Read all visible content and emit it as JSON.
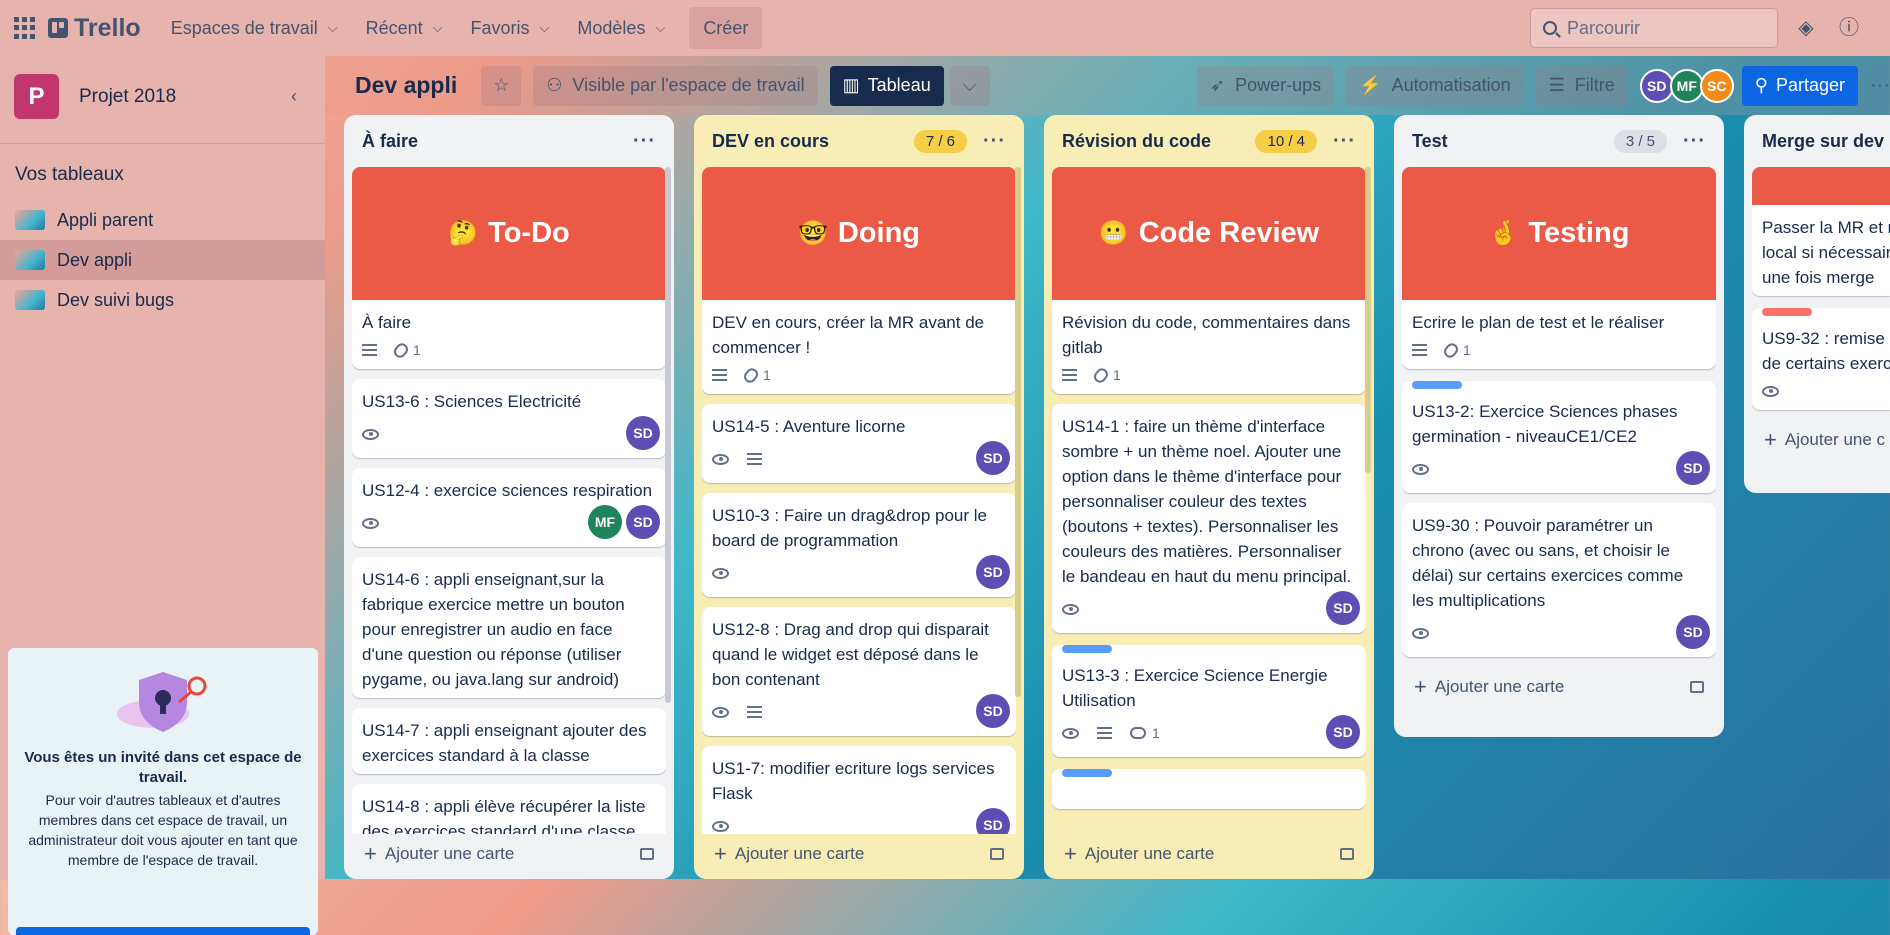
{
  "topbar": {
    "logo": "Trello",
    "menus": [
      "Espaces de travail",
      "Récent",
      "Favoris",
      "Modèles"
    ],
    "create": "Créer",
    "search_placeholder": "Parcourir"
  },
  "sidebar": {
    "workspace_initial": "P",
    "workspace_name": "Projet 2018",
    "section_title": "Vos tableaux",
    "boards": [
      {
        "label": "Appli parent"
      },
      {
        "label": "Dev appli"
      },
      {
        "label": "Dev suivi bugs"
      }
    ],
    "guest_title": "Vous êtes un invité dans cet espace de travail.",
    "guest_text": "Pour voir d'autres tableaux et d'autres membres dans cet espace de travail, un administrateur doit vous ajouter en tant que membre de l'espace de travail."
  },
  "board": {
    "title": "Dev appli",
    "visibility": "Visible par l'espace de travail",
    "view": "Tableau",
    "powerups": "Power-ups",
    "automation": "Automatisation",
    "filter": "Filtre",
    "share": "Partager",
    "members": [
      {
        "initials": "SD",
        "color": "#5e4db2"
      },
      {
        "initials": "MF",
        "color": "#1f845a"
      },
      {
        "initials": "SC",
        "color": "#f38a1a"
      }
    ]
  },
  "lists": [
    {
      "name": "À faire",
      "count": "",
      "add": "Ajouter une carte",
      "cover": {
        "emoji": "🤔",
        "title": "To-Do"
      },
      "cards": [
        {
          "text": "À faire",
          "badges": {
            "attach": "1"
          }
        },
        {
          "text": "US13-6 : Sciences Electricité",
          "members": [
            "SD"
          ]
        },
        {
          "text": "US12-4 : exercice sciences respiration",
          "members": [
            "MF",
            "SD"
          ]
        },
        {
          "text": "US14-6 : appli enseignant,sur la fabrique exercice mettre un bouton pour enregistrer un audio en face d'une question ou réponse (utiliser pygame, ou java.lang sur android)"
        },
        {
          "text": "US14-7 : appli enseignant ajouter des exercices standard à la classe"
        },
        {
          "text": "US14-8 : appli élève récupérer la liste des exercices standard d'une classe"
        }
      ]
    },
    {
      "name": "DEV en cours",
      "count": "7 / 6",
      "add": "Ajouter une carte",
      "cover": {
        "emoji": "🤓",
        "title": "Doing"
      },
      "cards": [
        {
          "text": "DEV en cours, créer la MR avant de commencer !",
          "badges": {
            "attach": "1"
          }
        },
        {
          "text": "US14-5 : Aventure licorne",
          "members": [
            "SD"
          ]
        },
        {
          "text": "US10-3 : Faire un drag&drop pour le board de programmation",
          "members": [
            "SD"
          ]
        },
        {
          "text": "US12-8 : Drag and drop qui disparait quand le widget est déposé dans le bon contenant",
          "members": [
            "SD"
          ]
        },
        {
          "text": "US1-7: modifier ecriture logs services Flask",
          "members": [
            "SD"
          ]
        }
      ]
    },
    {
      "name": "Révision du code",
      "count": "10 / 4",
      "add": "Ajouter une carte",
      "cover": {
        "emoji": "😬",
        "title": "Code Review"
      },
      "cards": [
        {
          "text": "Révision du code, commentaires dans gitlab",
          "badges": {
            "attach": "1"
          }
        },
        {
          "text": "US14-1 : faire un thème d'interface sombre + un thème noel. Ajouter une option dans le thème d'interface pour personnaliser couleur des textes (boutons + textes). Personnaliser les couleurs des matières. Personnaliser le bandeau en haut du menu principal.",
          "members": [
            "SD"
          ]
        },
        {
          "text": "US13-3 : Exercice Science Energie Utilisation",
          "members": [
            "SD"
          ],
          "comments": "1"
        }
      ]
    },
    {
      "name": "Test",
      "count": "3 / 5",
      "add": "Ajouter une carte",
      "cover": {
        "emoji": "🤞",
        "title": "Testing"
      },
      "cards": [
        {
          "text": "Ecrire le plan de test et le réaliser",
          "badges": {
            "attach": "1"
          }
        },
        {
          "text": "US13-2: Exercice Sciences phases germination - niveauCE1/CE2",
          "members": [
            "SD"
          ]
        },
        {
          "text": "US9-30 : Pouvoir paramétrer un chrono (avec ou sans, et choisir le délai) sur certains exercices comme les multiplications",
          "members": [
            "SD"
          ]
        }
      ]
    },
    {
      "name": "Merge sur dev",
      "add": "Ajouter une c",
      "cards": [
        {
          "text": "Passer la MR et r local si nécessair une fois merge"
        },
        {
          "text": "US9-32 : remise de certains exerc"
        }
      ]
    }
  ],
  "colors": {
    "accent": "#0c66e4",
    "cover": "#eb5a46",
    "label_blue": "#579dff",
    "label_red": "#f87168"
  }
}
